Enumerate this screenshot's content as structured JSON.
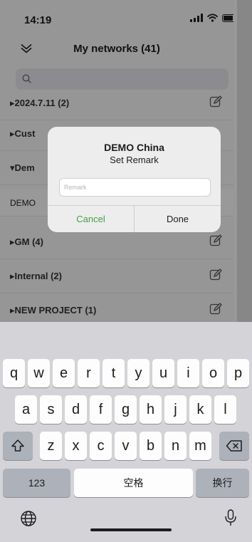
{
  "status_bar": {
    "time": "14:19"
  },
  "header": {
    "title": "My networks (41)"
  },
  "search": {
    "placeholder": ""
  },
  "groups": [
    {
      "label": "▸2024.7.11 (2)"
    },
    {
      "label": "▸Cust"
    },
    {
      "label": "▾Dem"
    },
    {
      "label": "▸GM (4)"
    },
    {
      "label": "▸Internal (2)"
    },
    {
      "label": "▸NEW PROJECT (1)"
    }
  ],
  "sub_item": {
    "label": "DEMO"
  },
  "dialog": {
    "title": "DEMO China",
    "message": "Set Remark",
    "input_placeholder": "Remark",
    "cancel_label": "Cancel",
    "done_label": "Done",
    "cancel_color": "#43a047"
  },
  "keyboard": {
    "row1": [
      "q",
      "w",
      "e",
      "r",
      "t",
      "y",
      "u",
      "i",
      "o",
      "p"
    ],
    "row2": [
      "a",
      "s",
      "d",
      "f",
      "g",
      "h",
      "j",
      "k",
      "l"
    ],
    "row3": [
      "z",
      "x",
      "c",
      "v",
      "b",
      "n",
      "m"
    ],
    "numbers_label": "123",
    "space_label": "空格",
    "return_label": "换行",
    "icons": [
      "shift-icon",
      "backspace-icon",
      "globe-icon",
      "microphone-icon"
    ]
  }
}
